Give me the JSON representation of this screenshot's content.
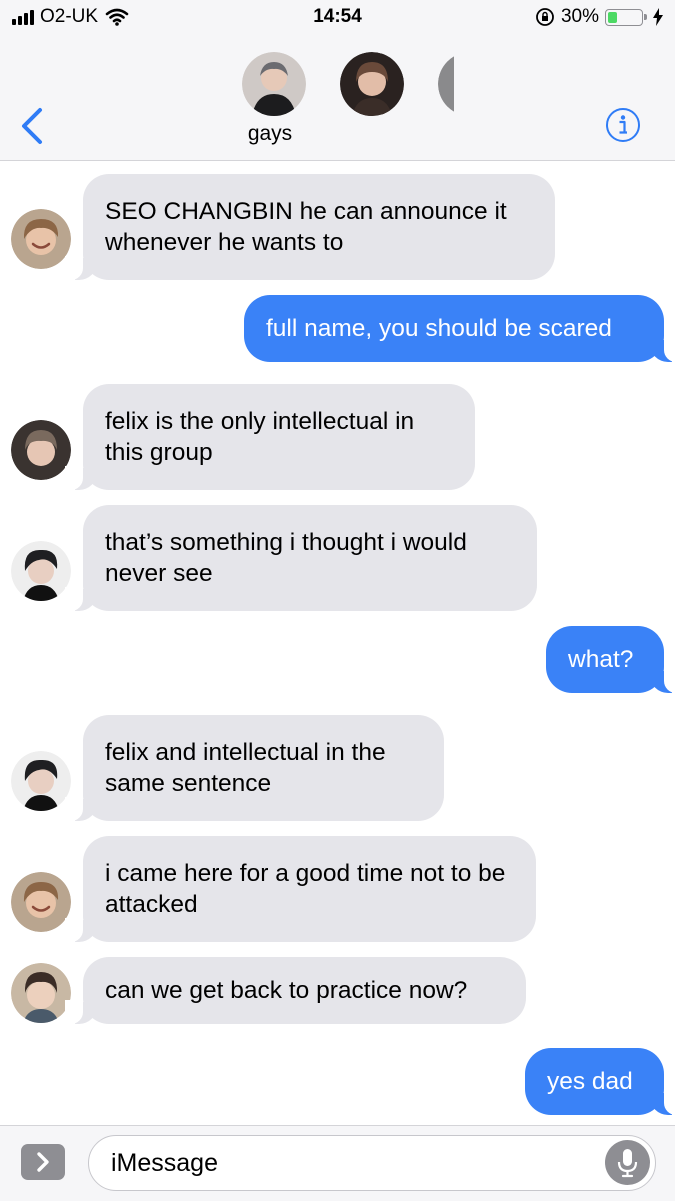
{
  "status_bar": {
    "carrier": "O2-UK",
    "time": "14:54",
    "battery_percent": "30%",
    "battery_level": 0.3,
    "icons": [
      "signal-bars-icon",
      "wifi-icon",
      "orientation-lock-icon",
      "battery-icon",
      "charging-bolt-icon"
    ]
  },
  "header": {
    "group_name": "gays",
    "back_icon": "chevron-left-icon",
    "info_icon": "info-icon",
    "avatar_count_visible": 3
  },
  "messages": [
    {
      "direction": "incoming",
      "text": "SEO CHANGBIN he can announce it whenever he wants to"
    },
    {
      "direction": "outgoing",
      "text": "full name, you should be scared"
    },
    {
      "direction": "incoming",
      "text": "felix is the only intellectual in this group"
    },
    {
      "direction": "incoming",
      "text": "that’s something i thought i would never see"
    },
    {
      "direction": "outgoing",
      "text": "what?"
    },
    {
      "direction": "incoming",
      "text": "felix and intellectual in the same sentence"
    },
    {
      "direction": "incoming",
      "text": "i came here for a good time not to be attacked"
    },
    {
      "direction": "incoming",
      "text": "can we get back to practice now?"
    },
    {
      "direction": "outgoing",
      "text": "yes dad"
    }
  ],
  "input_bar": {
    "placeholder": "iMessage",
    "apps_icon": "chevron-right-icon",
    "mic_icon": "microphone-icon"
  },
  "colors": {
    "incoming_bubble": "#e5e5ea",
    "outgoing_bubble": "#3a82f7",
    "accent": "#2f7cf6",
    "bar_background": "#f6f6f8"
  }
}
